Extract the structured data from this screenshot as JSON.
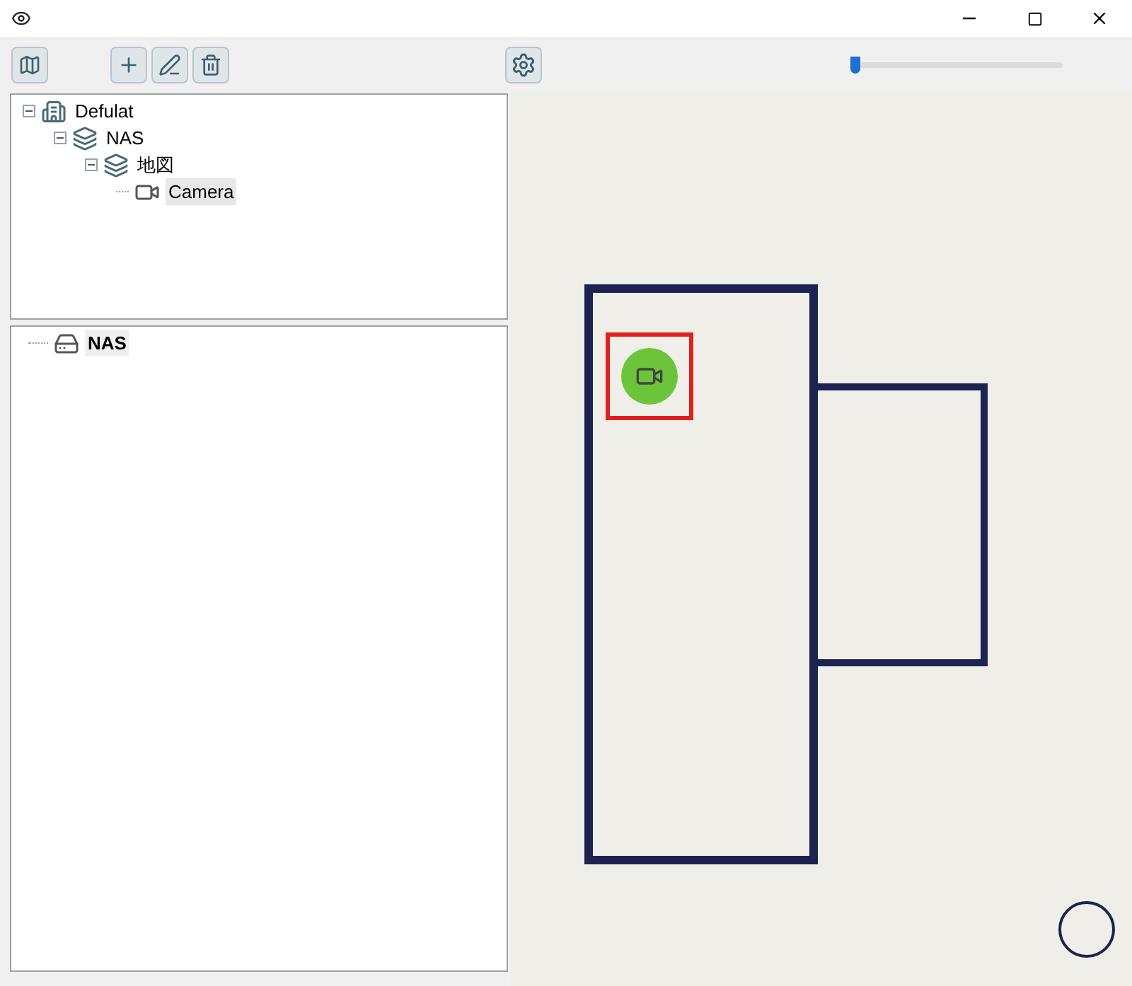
{
  "tree": [
    {
      "label": "Defulat",
      "kind": "site",
      "expanded": true,
      "selected": false,
      "children": [
        {
          "label": "NAS",
          "kind": "group",
          "expanded": true,
          "selected": false,
          "children": [
            {
              "label": "地図",
              "kind": "group",
              "expanded": true,
              "selected": false,
              "children": [
                {
                  "label": "Camera",
                  "kind": "camera",
                  "selected": true
                }
              ]
            }
          ]
        }
      ]
    }
  ],
  "devices": [
    {
      "label": "NAS",
      "selected": true
    }
  ],
  "zoom_slider": {
    "level": 0.0
  },
  "map": {
    "marker": {
      "selected": true
    }
  }
}
